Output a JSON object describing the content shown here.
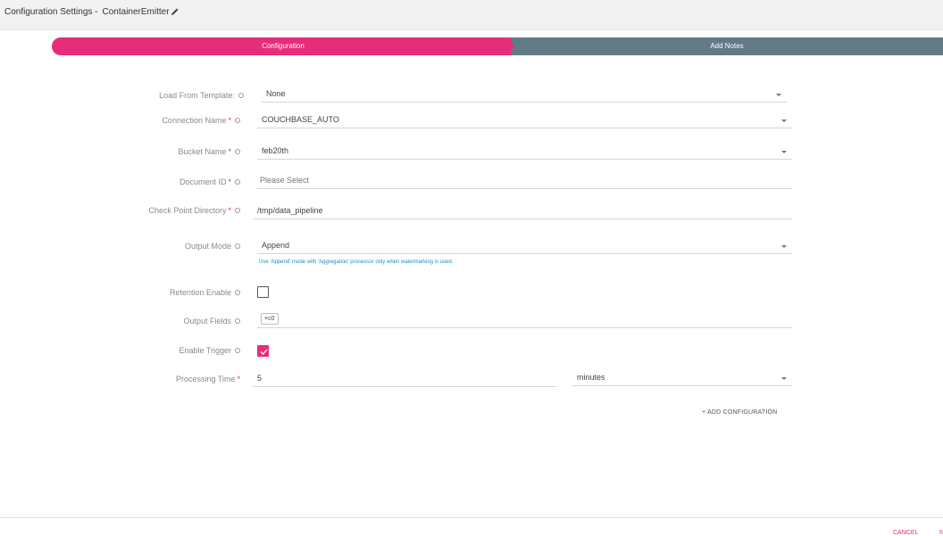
{
  "header": {
    "title": "Configuration Settings -",
    "component_name": "ContainerEmitter"
  },
  "stepper": {
    "steps": [
      {
        "label": "Configuration",
        "active": true
      },
      {
        "label": "Add Notes",
        "active": false
      }
    ]
  },
  "form": {
    "load_from_template": {
      "label": "Load From Template:",
      "value": "None"
    },
    "connection_name": {
      "label": "Connection Name",
      "required": "*",
      "value": "COUCHBASE_AUTO"
    },
    "bucket_name": {
      "label": "Bucket Name",
      "required": "*",
      "value": "feb20th"
    },
    "document_id": {
      "label": "Document ID",
      "required": "*",
      "placeholder": "Please Select"
    },
    "checkpoint_directory": {
      "label": "Check Point Directory",
      "required": "*",
      "value": "/tmp/data_pipeline"
    },
    "output_mode": {
      "label": "Output Mode",
      "value": "Append",
      "hint": "Use 'Append' mode with 'Aggregation' processor only when watermarking is used."
    },
    "retention_enable": {
      "label": "Retention Enable",
      "checked": false
    },
    "output_fields": {
      "label": "Output Fields",
      "chips": [
        "c0"
      ],
      "chip_remove": "×"
    },
    "enable_trigger": {
      "label": "Enable Trigger",
      "checked": true
    },
    "processing_time": {
      "label": "Processing Time",
      "required": "*",
      "value": "5",
      "unit": "minutes"
    },
    "add_configuration": "+ ADD CONFIGURATION"
  },
  "footer": {
    "cancel": "CANCEL",
    "next": "N"
  },
  "colors": {
    "accent": "#e62d7a",
    "step_inactive": "#627a87",
    "hint": "#1e8fb5"
  }
}
